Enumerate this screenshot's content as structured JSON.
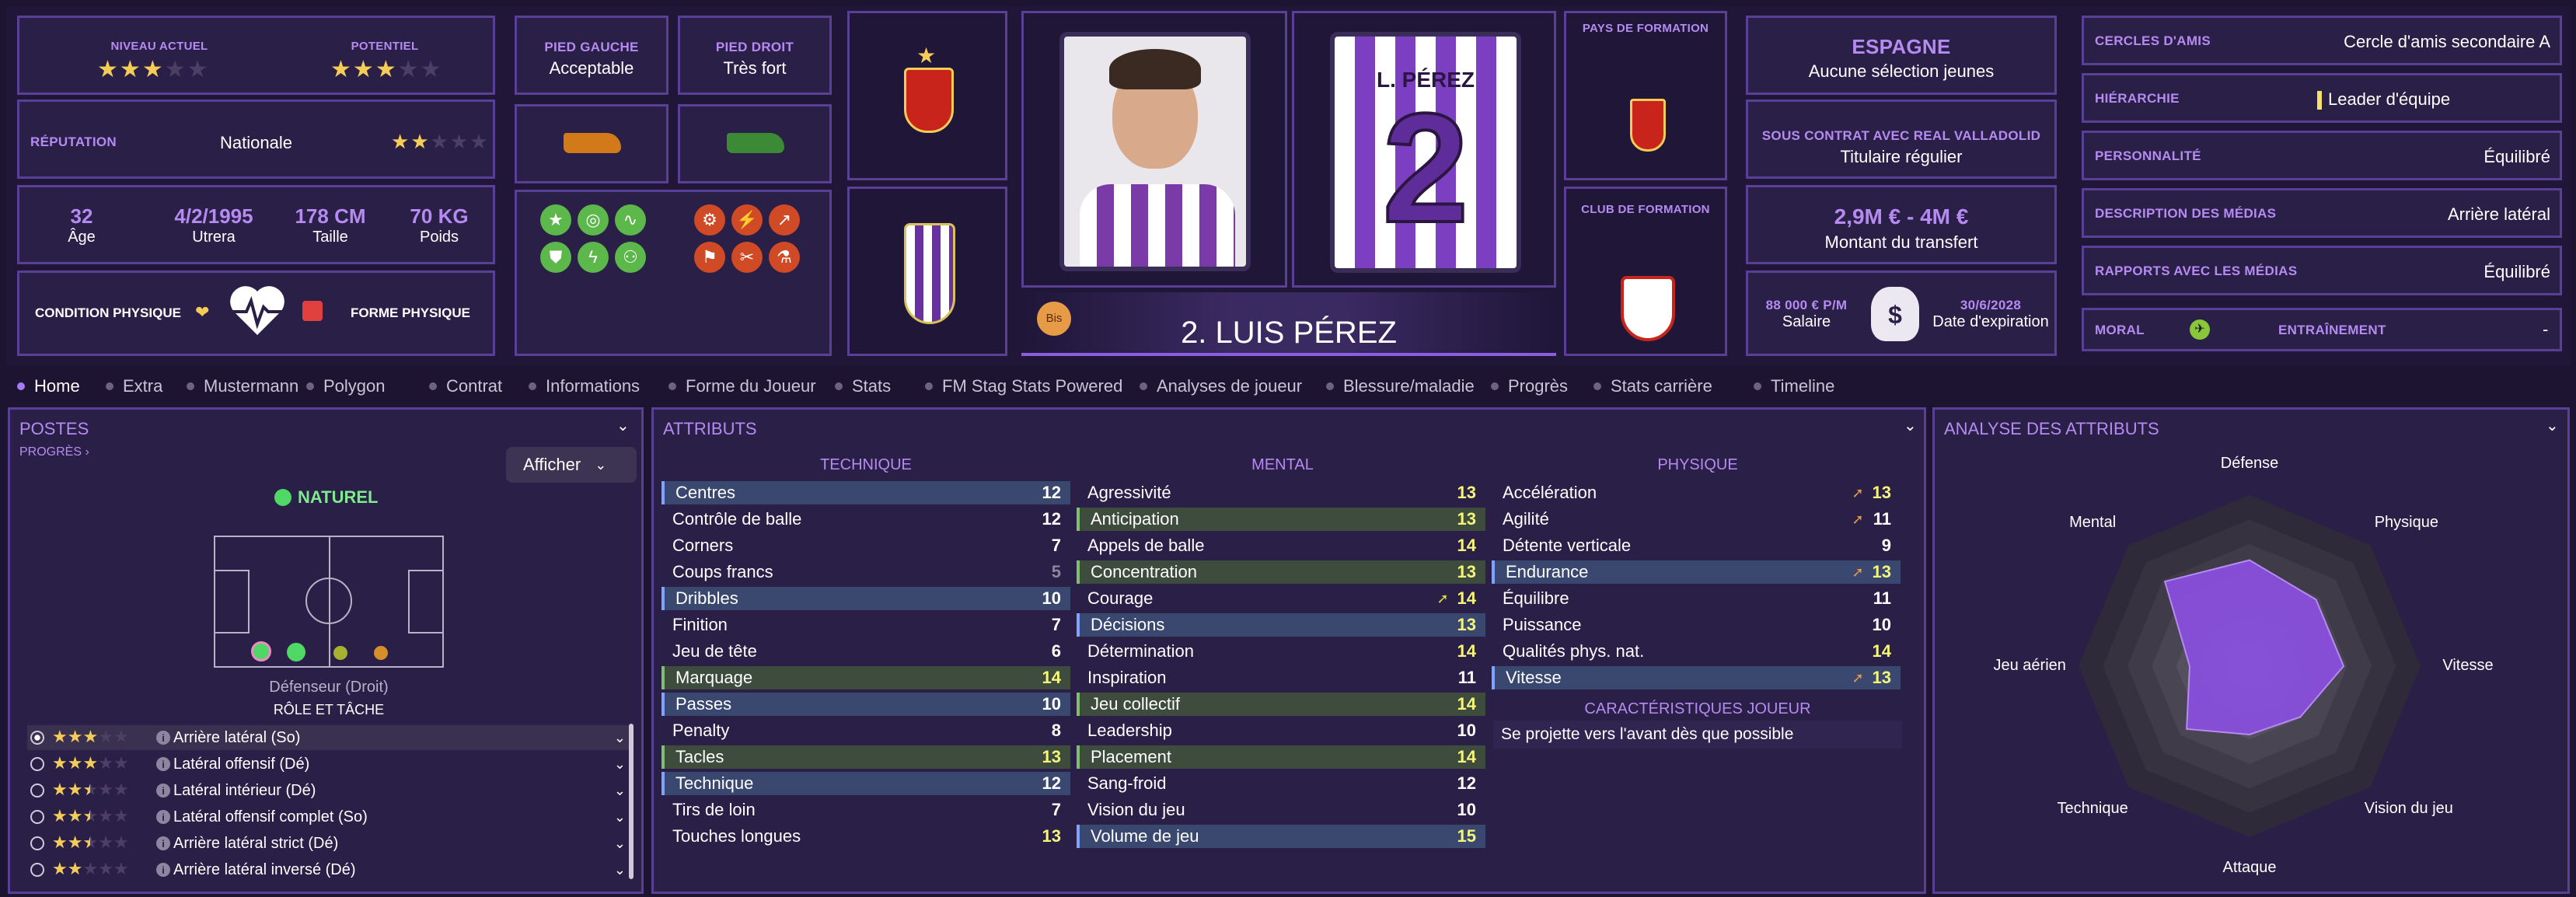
{
  "top": {
    "level": {
      "current_label": "NIVEAU ACTUEL",
      "potential_label": "POTENTIEL",
      "current_stars": 3,
      "potential_stars": 3
    },
    "reputation": {
      "label": "RÉPUTATION",
      "value": "Nationale",
      "stars": 2
    },
    "bio": {
      "age": "32",
      "age_label": "Âge",
      "dob": "4/2/1995",
      "dob_place": "Utrera",
      "height": "178 CM",
      "height_label": "Taille",
      "weight": "70 KG",
      "weight_label": "Poids"
    },
    "condition": {
      "left_label": "CONDITION PHYSIQUE",
      "right_label": "FORME PHYSIQUE"
    },
    "feet": {
      "left_label": "PIED GAUCHE",
      "left_value": "Acceptable",
      "right_label": "PIED DROIT",
      "right_value": "Très fort"
    },
    "player": {
      "number_name": "2. LUIS PÉREZ",
      "shirt_name": "L. PÉREZ",
      "shirt_number": "2",
      "badge": "Bis"
    },
    "formation": {
      "country_label": "PAYS DE FORMATION",
      "club_label": "CLUB DE FORMATION"
    },
    "nation": {
      "name": "ESPAGNE",
      "status": "Aucune sélection jeunes"
    },
    "contract": {
      "label": "SOUS CONTRAT AVEC REAL VALLADOLID",
      "status": "Titulaire régulier"
    },
    "transfer": {
      "range": "2,9M € - 4M €",
      "label": "Montant du transfert"
    },
    "wage": {
      "value": "88 000 € P/M",
      "label": "Salaire",
      "expiry": "30/6/2028",
      "expiry_label": "Date d'expiration"
    },
    "social": [
      {
        "label": "CERCLES D'AMIS",
        "value": "Cercle d'amis secondaire A"
      },
      {
        "label": "HIÉRARCHIE",
        "value": "Leader d'équipe"
      },
      {
        "label": "PERSONNALITÉ",
        "value": "Équilibré"
      },
      {
        "label": "DESCRIPTION DES MÉDIAS",
        "value": "Arrière latéral"
      },
      {
        "label": "RAPPORTS AVEC LES MÉDIAS",
        "value": "Équilibré"
      }
    ],
    "morale": {
      "label": "MORAL",
      "training_label": "ENTRAÎNEMENT",
      "training_value": "-"
    }
  },
  "tabs": [
    "Home",
    "Extra",
    "Mustermann",
    "Polygon",
    "Contrat",
    "Informations",
    "Forme du Joueur",
    "Stats",
    "FM Stag Stats Powered",
    "Analyses de joueur",
    "Blessure/maladie",
    "Progrès",
    "Stats carrière",
    "Timeline"
  ],
  "positions": {
    "title": "POSTES",
    "progress": "PROGRÈS",
    "show_button": "Afficher",
    "natural": "NATUREL",
    "position_name": "Défenseur (Droit)",
    "role_heading": "RÔLE ET TÂCHE",
    "roles": [
      {
        "name": "Arrière latéral (So)",
        "stars": 3
      },
      {
        "name": "Latéral offensif (Dé)",
        "stars": 3
      },
      {
        "name": "Latéral intérieur (Dé)",
        "stars": 2.5
      },
      {
        "name": "Latéral offensif complet (So)",
        "stars": 2.5
      },
      {
        "name": "Arrière latéral strict (Dé)",
        "stars": 2.5
      },
      {
        "name": "Arrière latéral inversé (Dé)",
        "stars": 2
      }
    ]
  },
  "attributes": {
    "title": "ATTRIBUTS",
    "technique_label": "TECHNIQUE",
    "mental_label": "MENTAL",
    "physique_label": "PHYSIQUE",
    "technique": [
      {
        "name": "Centres",
        "value": "12",
        "hl": "blue"
      },
      {
        "name": "Contrôle de balle",
        "value": "12",
        "hl": ""
      },
      {
        "name": "Corners",
        "value": "7",
        "hl": ""
      },
      {
        "name": "Coups francs",
        "value": "5",
        "hl": ""
      },
      {
        "name": "Dribbles",
        "value": "10",
        "hl": "blue"
      },
      {
        "name": "Finition",
        "value": "7",
        "hl": ""
      },
      {
        "name": "Jeu de tête",
        "value": "6",
        "hl": ""
      },
      {
        "name": "Marquage",
        "value": "14",
        "hl": "green"
      },
      {
        "name": "Passes",
        "value": "10",
        "hl": "blue"
      },
      {
        "name": "Penalty",
        "value": "8",
        "hl": ""
      },
      {
        "name": "Tacles",
        "value": "13",
        "hl": "green"
      },
      {
        "name": "Technique",
        "value": "12",
        "hl": "blue"
      },
      {
        "name": "Tirs de loin",
        "value": "7",
        "hl": ""
      },
      {
        "name": "Touches longues",
        "value": "13",
        "hl": ""
      }
    ],
    "mental": [
      {
        "name": "Agressivité",
        "value": "13",
        "hl": ""
      },
      {
        "name": "Anticipation",
        "value": "13",
        "hl": "green"
      },
      {
        "name": "Appels de balle",
        "value": "14",
        "hl": ""
      },
      {
        "name": "Concentration",
        "value": "13",
        "hl": "green"
      },
      {
        "name": "Courage",
        "value": "14",
        "hl": "",
        "arrow": "up"
      },
      {
        "name": "Décisions",
        "value": "13",
        "hl": "blue"
      },
      {
        "name": "Détermination",
        "value": "14",
        "hl": ""
      },
      {
        "name": "Inspiration",
        "value": "11",
        "hl": ""
      },
      {
        "name": "Jeu collectif",
        "value": "14",
        "hl": "green"
      },
      {
        "name": "Leadership",
        "value": "10",
        "hl": ""
      },
      {
        "name": "Placement",
        "value": "14",
        "hl": "green"
      },
      {
        "name": "Sang-froid",
        "value": "12",
        "hl": ""
      },
      {
        "name": "Vision du jeu",
        "value": "10",
        "hl": ""
      },
      {
        "name": "Volume de jeu",
        "value": "15",
        "hl": "blue"
      }
    ],
    "physique": [
      {
        "name": "Accélération",
        "value": "13",
        "hl": "",
        "arrow": "down"
      },
      {
        "name": "Agilité",
        "value": "11",
        "hl": "",
        "arrow": "down"
      },
      {
        "name": "Détente verticale",
        "value": "9",
        "hl": ""
      },
      {
        "name": "Endurance",
        "value": "13",
        "hl": "blue",
        "arrow": "down"
      },
      {
        "name": "Équilibre",
        "value": "11",
        "hl": ""
      },
      {
        "name": "Puissance",
        "value": "10",
        "hl": ""
      },
      {
        "name": "Qualités phys. nat.",
        "value": "14",
        "hl": ""
      },
      {
        "name": "Vitesse",
        "value": "13",
        "hl": "blue",
        "arrow": "down"
      }
    ],
    "traits_label": "CARACTÉRISTIQUES JOUEUR",
    "traits": [
      "Se projette vers l'avant dès que possible"
    ]
  },
  "analysis": {
    "title": "ANALYSE DES ATTRIBUTS",
    "axes": [
      "Défense",
      "Physique",
      "Vitesse",
      "Vision du jeu",
      "Attaque",
      "Technique",
      "Jeu aérien",
      "Mental"
    ]
  },
  "colors": {
    "accent": "#b58bf2",
    "bg": "#1c1430",
    "panel": "#2a1f47",
    "border": "#5a3f96",
    "star": "#f4cc56"
  }
}
